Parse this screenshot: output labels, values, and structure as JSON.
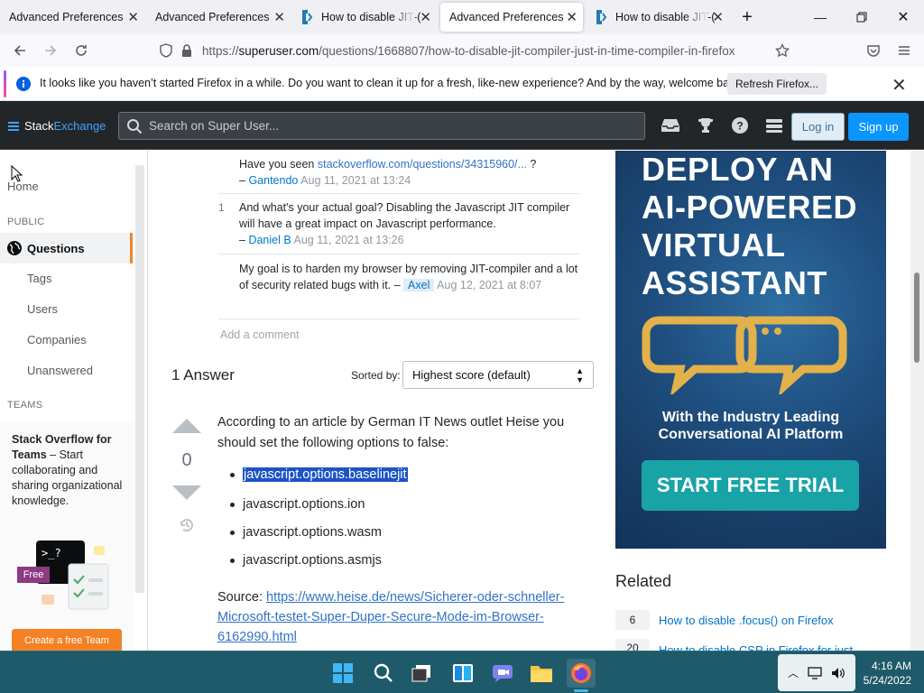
{
  "tabs": [
    {
      "title": "Advanced Preferences",
      "active": false
    },
    {
      "title": "Advanced Preferences",
      "active": false
    },
    {
      "title": "How to disable JIT-(",
      "active": false
    },
    {
      "title": "Advanced Preferences",
      "active": true
    },
    {
      "title": "How to disable JIT-(",
      "active": false
    }
  ],
  "url": {
    "host": "superuser.com",
    "path": "/questions/1668807/how-to-disable-jit-compiler-just-in-time-compiler-in-firefox",
    "scheme": "https://"
  },
  "notification": {
    "message": "It looks like you haven’t started Firefox in a while. Do you want to clean it up for a fresh, like-new experience? And by the way, welcome back!",
    "button": "Refresh Firefox..."
  },
  "header": {
    "logo_a": "Stack",
    "logo_b": "Exchange",
    "search_placeholder": "Search on Super User...",
    "login": "Log in",
    "signup": "Sign up"
  },
  "sidebar": {
    "home": "Home",
    "public_label": "PUBLIC",
    "questions": "Questions",
    "items": [
      "Tags",
      "Users",
      "Companies",
      "Unanswered"
    ],
    "teams_label": "TEAMS",
    "teams_title": "Stack Overflow for Teams",
    "teams_desc": " – Start collaborating and sharing organizational knowledge.",
    "free_badge": "Free",
    "teams_button": "Create a free Team"
  },
  "comments": [
    {
      "score": "",
      "pre": "Have you seen ",
      "link": "stackoverflow.com/questions/34315960/...",
      "post": " ?",
      "user": "Gantendo",
      "date": "Aug 11, 2021 at 13:24"
    },
    {
      "score": "1",
      "text": "And what's your actual goal? Disabling the Javascript JIT compiler will have a great impact on Javascript performance.",
      "user": "Daniel B",
      "date": "Aug 11, 2021 at 13:26"
    },
    {
      "score": "",
      "text": "My goal is to harden my browser by removing JIT-compiler and a lot of security related bugs with it.",
      "user": "Axel",
      "date": "Aug 12, 2021 at 8:07"
    }
  ],
  "add_comment": "Add a comment",
  "answers": {
    "heading": "1 Answer",
    "sorted_by": "Sorted by:",
    "sort_value": "Highest score (default)",
    "vote_count": "0",
    "intro": "According to an article by German IT News outlet Heise you should set the following options to false:",
    "options": [
      "javascript.options.baselinejit",
      "javascript.options.ion",
      "javascript.options.wasm",
      "javascript.options.asmjs"
    ],
    "source_label": "Source: ",
    "source_link": "https://www.heise.de/news/Sicherer-oder-schneller-Microsoft-testet-Super-Duper-Secure-Mode-im-Browser-6162990.html"
  },
  "ad": {
    "headline": "DEPLOY AN AI-POWERED VIRTUAL ASSISTANT",
    "sub": "With the Industry Leading Conversational AI Platform",
    "cta": "START FREE TRIAL",
    "colors": {
      "bubble": "#e3b14a",
      "cta_bg": "#18a3a7"
    }
  },
  "related": {
    "heading": "Related",
    "items": [
      {
        "score": "6",
        "title": "How to disable .focus() on Firefox"
      },
      {
        "score": "20",
        "title": "How to disable CSP in Firefox for just"
      }
    ]
  },
  "clock": {
    "time": "4:16 AM",
    "date": "5/24/2022"
  },
  "colors": {
    "se_header": "#232629",
    "accent_orange": "#f48225",
    "link_blue": "#0074cc",
    "taskbar": "#1f5a6a"
  }
}
